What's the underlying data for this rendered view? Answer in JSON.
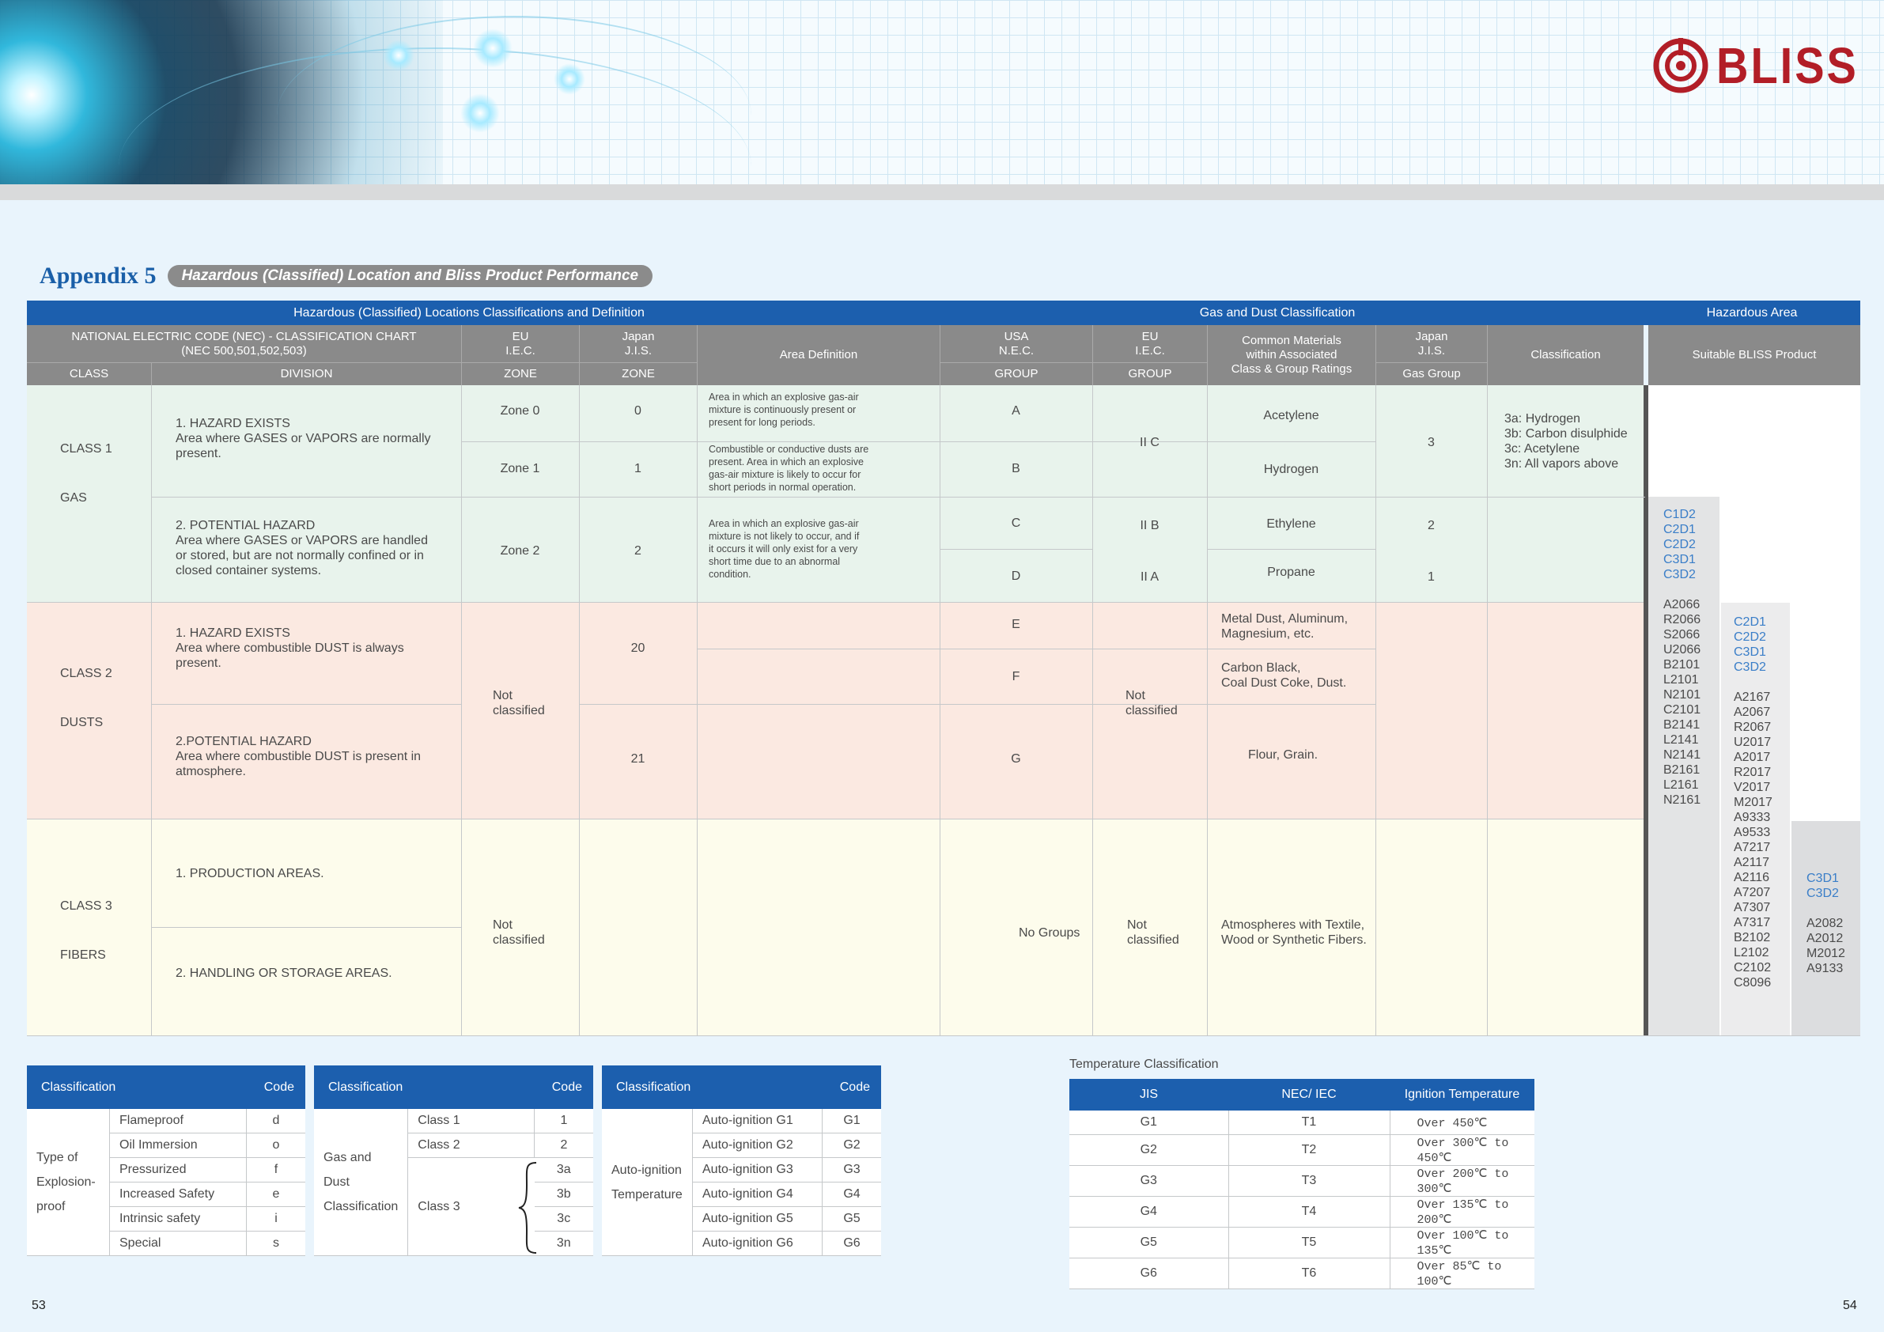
{
  "brand": {
    "logo_text": "BLISS",
    "color": "#b21e27"
  },
  "title": {
    "main": "Appendix 5",
    "subtitle": "Hazardous (Classified) Location and Bliss Product Performance"
  },
  "main_table": {
    "top_headers": {
      "left": "Hazardous (Classified) Locations Classifications and Definition",
      "middle": "Gas and Dust Classification",
      "right": "Hazardous Area"
    },
    "col_headers": {
      "nec_line1": "NATIONAL ELECTRIC CODE (NEC) -  CLASSIFICATION CHART",
      "nec_line2": "(NEC 500,501,502,503)",
      "eu_iec_line1": "EU",
      "eu_iec_line2": "I.E.C.",
      "japan_line1": "Japan",
      "japan_line2": "J.I.S.",
      "area_definition": "Area Definition",
      "usa_line1": "USA",
      "usa_line2": "N.E.C.",
      "eu2_line1": "EU",
      "eu2_line2": "I.E.C.",
      "common_line1": "Common Materials",
      "common_line2": "within Associated",
      "common_line3": "Class & Group Ratings",
      "japan2_line1": "Japan",
      "japan2_line2": "J.I.S.",
      "classification": "Classification",
      "suitable": "Suitable BLISS Product",
      "class": "CLASS",
      "division": "DIVISION",
      "zone": "ZONE",
      "zone2": "ZONE",
      "group": "GROUP",
      "group2": "GROUP",
      "gas_group": "Gas Group"
    },
    "class1": {
      "label_line1": "CLASS  1",
      "label_line2": "GAS",
      "div1_line1": "1. HAZARD EXISTS",
      "div1_line2": "Area where GASES or VAPORS are normally",
      "div1_line3": "present.",
      "div2_line1": "2. POTENTIAL HAZARD",
      "div2_line2": "Area where GASES or VAPORS are handled",
      "div2_line3": "or stored, but are not normally confined or in",
      "div2_line4": "closed container systems.",
      "zone0": "Zone 0",
      "zone1": "Zone 1",
      "zone2": "Zone 2",
      "jis0": "0",
      "jis1": "1",
      "jis2": "2",
      "def_a_line1": "Area in which an explosive gas-air",
      "def_a_line2": "mixture is continuously present or",
      "def_a_line3": "present for long periods.",
      "def_b_line1": "Combustible or conductive dusts are",
      "def_b_line2": "present. Area in which an explosive",
      "def_b_line3": "gas-air mixture is likely to occur for",
      "def_b_line4": "short periods in normal operation.",
      "def_c_line1": "Area in which an explosive gas-air",
      "def_c_line2": "mixture is not likely to occur, and if",
      "def_c_line3": "it occurs it will only exist for a very",
      "def_c_line4": "short time due to an abnormal",
      "def_c_line5": "condition.",
      "group_a": "A",
      "group_b": "B",
      "group_c": "C",
      "group_d": "D",
      "iec_iic": "II C",
      "iec_iib": "II B",
      "iec_iia": "II A",
      "mat_a": "Acetylene",
      "mat_b": "Hydrogen",
      "mat_c": "Ethylene",
      "mat_d": "Propane",
      "jis_group_ab": "3",
      "jis_group_c": "2",
      "jis_group_d": "1",
      "cls_line1": "3a: Hydrogen",
      "cls_line2": "3b: Carbon disulphide",
      "cls_line3": "3c: Acetylene",
      "cls_line4": "3n: All vapors above"
    },
    "class2": {
      "label_line1": "CLASS  2",
      "label_line2": "DUSTS",
      "div1_line1": "1. HAZARD EXISTS",
      "div1_line2": "Area where combustible DUST is always",
      "div1_line3": "present.",
      "div2_line1": "2.POTENTIAL HAZARD",
      "div2_line2": "Area where combustible DUST is present in",
      "div2_line3": "atmosphere.",
      "zone_line1": "Not",
      "zone_line2": "classified",
      "jis_20": "20",
      "jis_21": "21",
      "group_e": "E",
      "group_f": "F",
      "group_g": "G",
      "iec_line1": "Not",
      "iec_line2": "classified",
      "mat_e_line1": "Metal Dust, Aluminum,",
      "mat_e_line2": "Magnesium, etc.",
      "mat_f_line1": "Carbon Black,",
      "mat_f_line2": "Coal Dust Coke, Dust.",
      "mat_g": "Flour, Grain."
    },
    "class3": {
      "label_line1": "CLASS  3",
      "label_line2": "FIBERS",
      "div1": "1. PRODUCTION AREAS.",
      "div2": "2. HANDLING OR STORAGE AREAS.",
      "zone_line1": "Not",
      "zone_line2": "classified",
      "group": "No Groups",
      "iec_line1": "Not",
      "iec_line2": "classified",
      "mat_line1": "Atmospheres with Textile,",
      "mat_line2": "Wood or Synthetic Fibers."
    },
    "products": {
      "col1_blue": [
        "C1D2",
        "C2D1",
        "C2D2",
        "C3D1",
        "C3D2"
      ],
      "col1_models": [
        "A2066",
        "R2066",
        "S2066",
        "U2066",
        "B2101",
        "L2101",
        "N2101",
        "C2101",
        "B2141",
        "L2141",
        "N2141",
        "B2161",
        "L2161",
        "N2161"
      ],
      "col2_blue": [
        "C2D1",
        "C2D2",
        "C3D1",
        "C3D2"
      ],
      "col2_models": [
        "A2167",
        "A2067",
        "R2067",
        "U2017",
        "A2017",
        "R2017",
        "V2017",
        "M2017",
        "A9333",
        "A9533",
        "A7217",
        "A2117",
        "A2116",
        "A7207",
        "A7307",
        "A7317",
        "B2102",
        "L2102",
        "C2102",
        "C8096"
      ],
      "col3_blue": [
        "C3D1",
        "C3D2"
      ],
      "col3_models": [
        "A2082",
        "A2012",
        "M2012",
        "A9133"
      ]
    }
  },
  "table_explosion": {
    "h_class": "Classification",
    "h_code": "Code",
    "group_line1": "Type of",
    "group_line2": "Explosion-",
    "group_line3": "proof",
    "rows": [
      {
        "name": "Flameproof",
        "code": "d"
      },
      {
        "name": "Oil Immersion",
        "code": "o"
      },
      {
        "name": "Pressurized",
        "code": "f"
      },
      {
        "name": "Increased Safety",
        "code": "e"
      },
      {
        "name": "Intrinsic safety",
        "code": "i"
      },
      {
        "name": "Special",
        "code": "s"
      }
    ]
  },
  "table_gasdust": {
    "h_class": "Classification",
    "h_code": "Code",
    "group_line1": "Gas and",
    "group_line2": "Dust",
    "group_line3": "Classification",
    "class1": "Class  1",
    "class1_code": "1",
    "class2": "Class 2",
    "class2_code": "2",
    "class3": "Class 3",
    "class3_codes": [
      "3a",
      "3b",
      "3c",
      "3n"
    ]
  },
  "table_autoignition": {
    "h_class": "Classification",
    "h_code": "Code",
    "group_line1": "Auto-ignition",
    "group_line2": "Temperature",
    "rows": [
      {
        "name": "Auto-ignition G1",
        "code": "G1"
      },
      {
        "name": "Auto-ignition G2",
        "code": "G2"
      },
      {
        "name": "Auto-ignition G3",
        "code": "G3"
      },
      {
        "name": "Auto-ignition G4",
        "code": "G4"
      },
      {
        "name": "Auto-ignition G5",
        "code": "G5"
      },
      {
        "name": "Auto-ignition G6",
        "code": "G6"
      }
    ]
  },
  "table_temperature": {
    "title": "Temperature Classification",
    "h_jis": "JIS",
    "h_nec": "NEC/ IEC",
    "h_temp": "Ignition Temperature",
    "rows": [
      {
        "jis": "G1",
        "nec": "T1",
        "temp": "Over 450℃"
      },
      {
        "jis": "G2",
        "nec": "T2",
        "temp": "Over 300℃ to 450℃"
      },
      {
        "jis": "G3",
        "nec": "T3",
        "temp": "Over 200℃ to 300℃"
      },
      {
        "jis": "G4",
        "nec": "T4",
        "temp": "Over 135℃ to 200℃"
      },
      {
        "jis": "G5",
        "nec": "T5",
        "temp": "Over 100℃ to 135℃"
      },
      {
        "jis": "G6",
        "nec": "T6",
        "temp": "Over 85℃ to 100℃"
      }
    ]
  },
  "page_numbers": {
    "left": "53",
    "right": "54"
  },
  "colors": {
    "header_blue": "#1c5fae",
    "header_grey": "#8a8a8a",
    "gas_bg": "#e8f3ec",
    "dust_bg": "#fbe9e1",
    "fiber_bg": "#fdfcec",
    "product_blue": "#3a7ec8"
  }
}
